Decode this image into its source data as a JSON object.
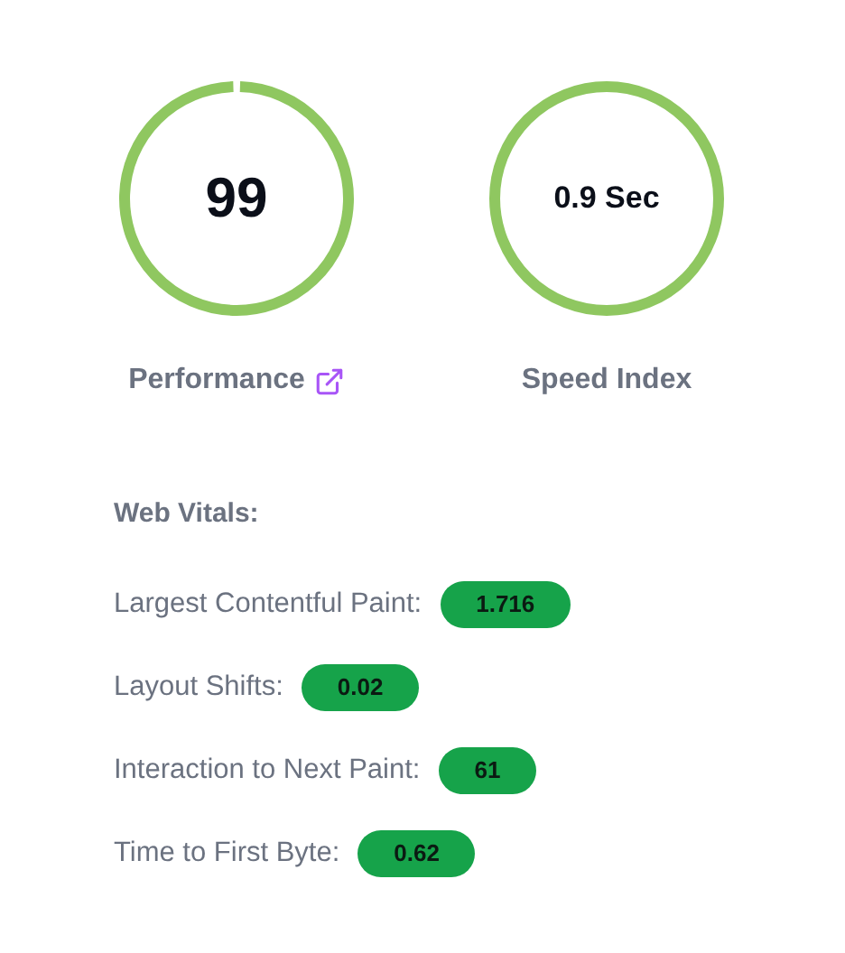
{
  "scores": [
    {
      "value": "99",
      "label": "Performance",
      "link": true,
      "level": 0.99
    },
    {
      "value": "0.9 Sec",
      "label": "Speed Index",
      "link": false
    }
  ],
  "web_vitals": {
    "title": "Web Vitals:",
    "items": [
      {
        "label": "Largest Contentful Paint:",
        "value": "1.716"
      },
      {
        "label": "Layout Shifts:",
        "value": "0.02"
      },
      {
        "label": "Interaction to Next Paint:",
        "value": "61"
      },
      {
        "label": "Time to First Byte:",
        "value": "0.62"
      }
    ]
  }
}
